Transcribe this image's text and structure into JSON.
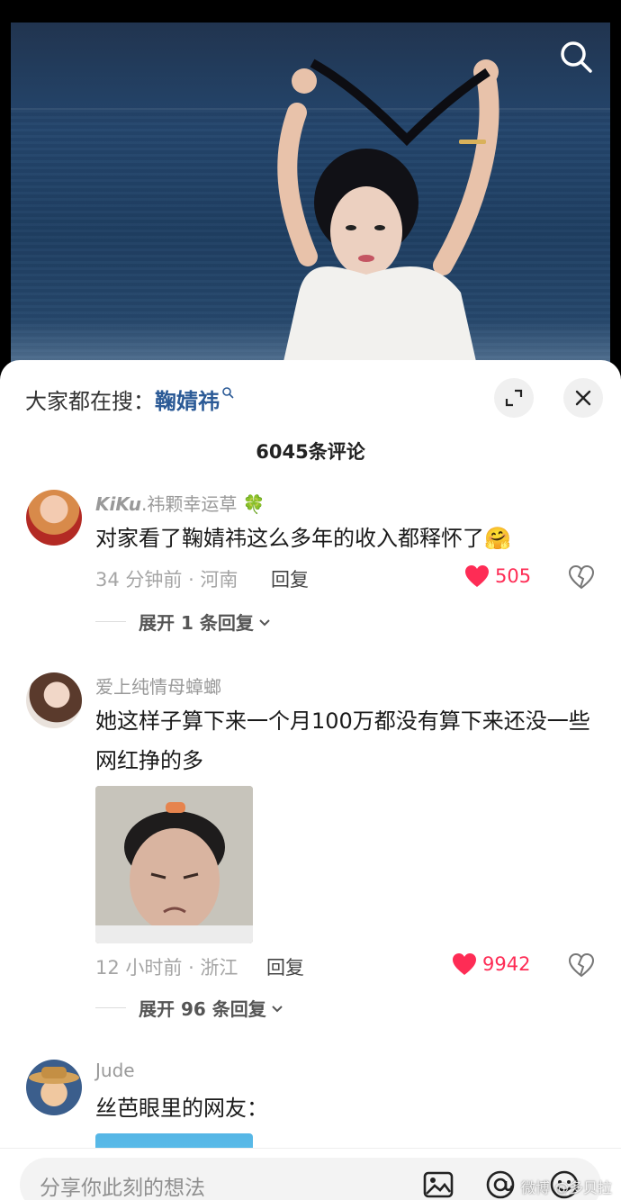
{
  "header": {
    "search_prefix": "大家都在搜：",
    "search_term": "鞠婧祎",
    "small_search_glyph": "⌕"
  },
  "comments_count": "6045条评论",
  "comments": [
    {
      "username_styled": "KiKu",
      "username_rest": ".祎颗幸运草",
      "clover": "🍀",
      "text": "对家看了鞠婧祎这么多年的收入都释怀了",
      "emoji": "🤗",
      "time_location": "34 分钟前 · 河南",
      "reply_label": "回复",
      "likes": "505",
      "expand_label": "展开 1 条回复"
    },
    {
      "username": "爱上纯情母蟑螂",
      "text": "她这样子算下来一个月100万都没有算下来还没一些网红挣的多",
      "time_location": "12 小时前 · 浙江",
      "reply_label": "回复",
      "likes": "9942",
      "expand_label": "展开 96 条回复"
    },
    {
      "username": "Jude",
      "text": "丝芭眼里的网友："
    }
  ],
  "input": {
    "placeholder": "分享你此刻的想法"
  },
  "watermark": "微博 @多贝拉",
  "colors": {
    "like": "#fe2c55",
    "search_term": "#2b5a96"
  },
  "icons": [
    "search-icon",
    "expand-icon",
    "close-icon",
    "heart-icon",
    "broken-heart-icon",
    "image-icon",
    "at-icon",
    "emoji-icon",
    "chevron-down-icon"
  ]
}
